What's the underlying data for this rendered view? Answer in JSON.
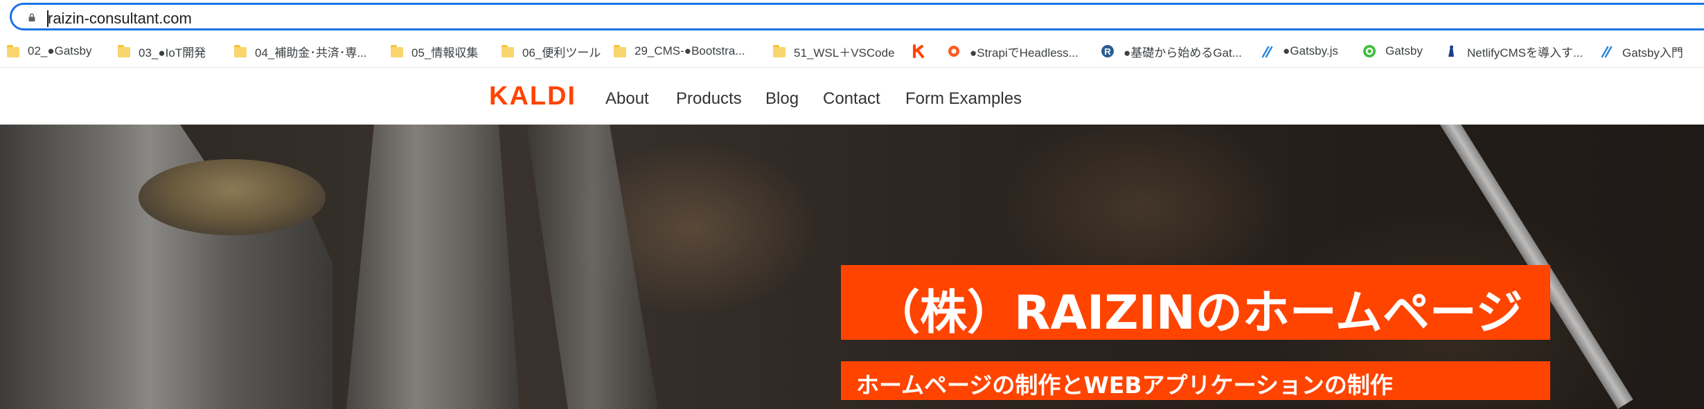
{
  "browser": {
    "url": "raizin-consultant.com",
    "bookmarks": [
      {
        "label": "02_●Gatsby",
        "icon": "folder-icon"
      },
      {
        "label": "03_●IoT開発",
        "icon": "folder-icon"
      },
      {
        "label": "04_補助金･共済･専...",
        "icon": "folder-icon"
      },
      {
        "label": "05_情報収集",
        "icon": "folder-icon"
      },
      {
        "label": "06_便利ツール",
        "icon": "folder-icon"
      },
      {
        "label": "29_CMS-●Bootstra...",
        "icon": "folder-icon"
      },
      {
        "label": "51_WSL＋VSCode",
        "icon": "folder-icon"
      },
      {
        "label": "",
        "icon": "k-favicon"
      },
      {
        "label": "●StrapiでHeadless...",
        "icon": "strapi-favicon"
      },
      {
        "label": "●基礎から始めるGat...",
        "icon": "r-favicon"
      },
      {
        "label": "●Gatsby.js",
        "icon": "netlify-favicon"
      },
      {
        "label": "Gatsby",
        "icon": "green-at-favicon"
      },
      {
        "label": "NetlifyCMSを導入す...",
        "icon": "person-favicon"
      },
      {
        "label": "Gatsby入門",
        "icon": "netlify-favicon"
      }
    ]
  },
  "site": {
    "logo": "KALDI",
    "nav": [
      "About",
      "Products",
      "Blog",
      "Contact",
      "Form Examples"
    ],
    "hero_title": "（株）RAIZINのホームページ",
    "hero_subtitle": "ホームページの制作とWEBアプリケーションの制作"
  },
  "colors": {
    "accent": "#ff4400",
    "omnibox_focus": "#1a73e8"
  }
}
